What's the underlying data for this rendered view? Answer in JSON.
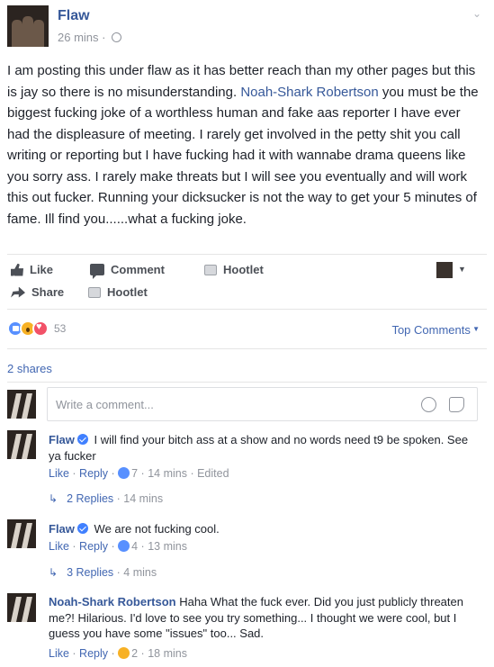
{
  "post": {
    "page_name": "Flaw",
    "time": "26 mins",
    "body_before": "I am posting this under flaw as it has better reach than my other pages but this is jay so there is no misunderstanding.",
    "mention": "Noah-Shark Robertson",
    "body_after": "you must be the biggest fucking joke of a worthless human and fake aas reporter I have ever had the displeasure of meeting. I rarely get involved in the petty shit you call writing or reporting but I have fucking had it with wannabe drama queens like you sorry ass. I rarely make threats but I will see you eventually and will work this out fucker. Running your dicksucker is not the way to get your 5 minutes of fame. Ill find you......what a fucking joke."
  },
  "actions": {
    "like": "Like",
    "comment": "Comment",
    "hootlet_1": "Hootlet",
    "share": "Share",
    "hootlet_2": "Hootlet"
  },
  "reactions": {
    "types": [
      "like",
      "wow",
      "love"
    ],
    "count": "53",
    "top_comments": "Top Comments",
    "shares": "2 shares"
  },
  "write_comment": {
    "placeholder": "Write a comment..."
  },
  "comments": [
    {
      "name": "Flaw",
      "verified": true,
      "text": "I will find your bitch ass at a show and no words need t9 be spoken. See ya fucker",
      "like": "Like",
      "reply": "Reply",
      "reaction_count": "7",
      "time": "14 mins",
      "edited": "Edited",
      "replies_label": "2 Replies",
      "replies_time": "14 mins"
    },
    {
      "name": "Flaw",
      "verified": true,
      "text": "We are not fucking cool.",
      "like": "Like",
      "reply": "Reply",
      "reaction_count": "4",
      "time": "13 mins",
      "replies_label": "3 Replies",
      "replies_time": "4 mins"
    },
    {
      "name": "Noah-Shark Robertson",
      "verified": false,
      "text": "Haha What the fuck ever. Did you just publicly threaten me?! Hilarious. I'd love to see you try something... I thought we were cool, but I guess you have some \"issues\" too... Sad.",
      "like": "Like",
      "reply": "Reply",
      "reaction_count": "2",
      "time": "18 mins"
    }
  ],
  "colors": {
    "link": "#365899",
    "accent": "#4267b2",
    "meta": "#90949c",
    "text": "#1d2129"
  }
}
